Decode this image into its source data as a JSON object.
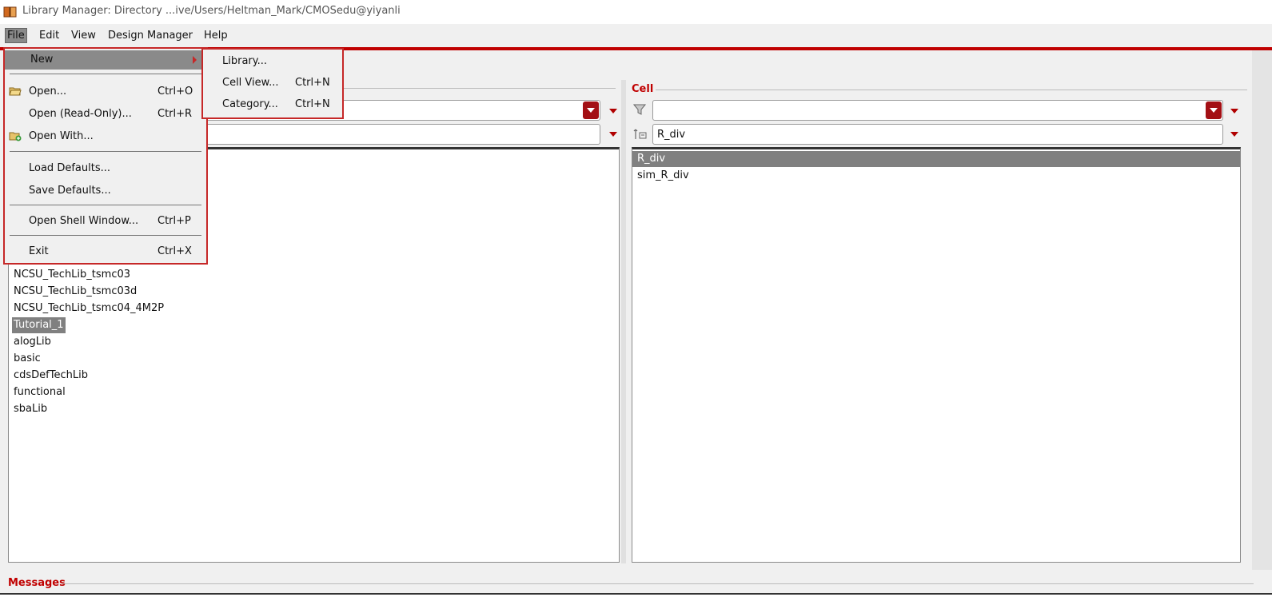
{
  "window": {
    "title": "Library Manager: Directory ...ive/Users/Heltman_Mark/CMOSedu@yiyanli"
  },
  "menubar": {
    "items": [
      {
        "label": "File"
      },
      {
        "label": "Edit"
      },
      {
        "label": "View"
      },
      {
        "label": "Design Manager"
      },
      {
        "label": "Help"
      }
    ]
  },
  "file_menu": {
    "items": [
      {
        "label": "New",
        "shortcut": ""
      },
      {
        "label": "Open...",
        "shortcut": "Ctrl+O"
      },
      {
        "label": "Open (Read-Only)...",
        "shortcut": "Ctrl+R"
      },
      {
        "label": "Open With...",
        "shortcut": ""
      },
      {
        "label": "Load Defaults...",
        "shortcut": ""
      },
      {
        "label": "Save Defaults...",
        "shortcut": ""
      },
      {
        "label": "Open Shell Window...",
        "shortcut": "Ctrl+P"
      },
      {
        "label": "Exit",
        "shortcut": "Ctrl+X"
      }
    ]
  },
  "new_submenu": {
    "items": [
      {
        "label": "Library...",
        "shortcut": ""
      },
      {
        "label": "Cell View...",
        "shortcut": "Ctrl+N"
      },
      {
        "label": "Category...",
        "shortcut": "Ctrl+N"
      }
    ]
  },
  "library_panel": {
    "items": [
      "NCSU_TechLib_tsmc03",
      "NCSU_TechLib_tsmc03d",
      "NCSU_TechLib_tsmc04_4M2P",
      "Tutorial_1",
      "alogLib",
      "basic",
      "cdsDefTechLib",
      "functional",
      "sbaLib"
    ],
    "selected": "Tutorial_1"
  },
  "cell_panel": {
    "label": "Cell",
    "filter_value": "",
    "search_value": "R_div",
    "items": [
      "R_div",
      "sim_R_div"
    ],
    "selected": "R_div"
  },
  "messages": {
    "label": "Messages"
  },
  "colors": {
    "accent": "#c00000",
    "selection": "#808080"
  }
}
